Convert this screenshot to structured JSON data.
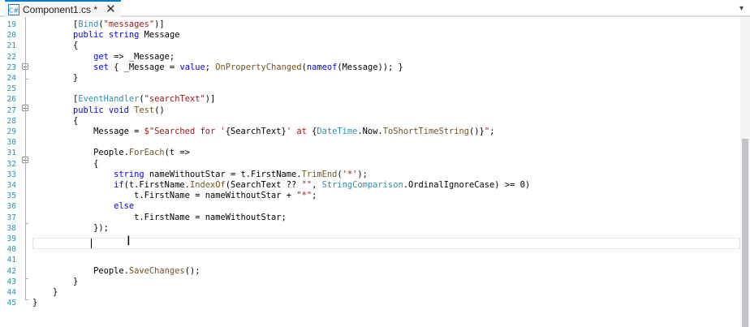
{
  "tab": {
    "title": "Component1.cs *",
    "icon": "csharp-file-icon",
    "close": "✕",
    "overflow": "▾"
  },
  "editor": {
    "lines": [
      {
        "n": "19",
        "indent": "        ",
        "tokens": [
          {
            "t": "[",
            "c": ""
          },
          {
            "t": "Bind",
            "c": "type"
          },
          {
            "t": "(",
            "c": ""
          },
          {
            "t": "\"messages\"",
            "c": "str"
          },
          {
            "t": ")]",
            "c": ""
          }
        ]
      },
      {
        "n": "20",
        "indent": "        ",
        "tokens": [
          {
            "t": "public",
            "c": "kw"
          },
          {
            "t": " ",
            "c": ""
          },
          {
            "t": "string",
            "c": "kw"
          },
          {
            "t": " Message",
            "c": ""
          }
        ]
      },
      {
        "n": "21",
        "indent": "        ",
        "tokens": [
          {
            "t": "{",
            "c": ""
          }
        ]
      },
      {
        "n": "22",
        "indent": "            ",
        "tokens": [
          {
            "t": "get",
            "c": "kw"
          },
          {
            "t": " => _Message;",
            "c": ""
          }
        ]
      },
      {
        "n": "23",
        "indent": "            ",
        "tokens": [
          {
            "t": "set",
            "c": "kw"
          },
          {
            "t": " { _Message = ",
            "c": ""
          },
          {
            "t": "value",
            "c": "kw"
          },
          {
            "t": "; ",
            "c": ""
          },
          {
            "t": "OnPropertyChanged",
            "c": "method"
          },
          {
            "t": "(",
            "c": ""
          },
          {
            "t": "nameof",
            "c": "kw"
          },
          {
            "t": "(Message)); }",
            "c": ""
          }
        ]
      },
      {
        "n": "24",
        "indent": "        ",
        "tokens": [
          {
            "t": "}",
            "c": ""
          }
        ]
      },
      {
        "n": "25",
        "indent": "",
        "tokens": []
      },
      {
        "n": "26",
        "indent": "        ",
        "tokens": [
          {
            "t": "[",
            "c": ""
          },
          {
            "t": "EventHandler",
            "c": "type"
          },
          {
            "t": "(",
            "c": ""
          },
          {
            "t": "\"searchText\"",
            "c": "str"
          },
          {
            "t": ")]",
            "c": ""
          }
        ]
      },
      {
        "n": "27",
        "indent": "        ",
        "tokens": [
          {
            "t": "public",
            "c": "kw"
          },
          {
            "t": " ",
            "c": ""
          },
          {
            "t": "void",
            "c": "kw"
          },
          {
            "t": " ",
            "c": ""
          },
          {
            "t": "Test",
            "c": "method"
          },
          {
            "t": "()",
            "c": ""
          }
        ]
      },
      {
        "n": "28",
        "indent": "        ",
        "tokens": [
          {
            "t": "{",
            "c": ""
          }
        ]
      },
      {
        "n": "29",
        "indent": "            ",
        "tokens": [
          {
            "t": "Message = ",
            "c": ""
          },
          {
            "t": "$\"Searched for '",
            "c": "str"
          },
          {
            "t": "{SearchText}",
            "c": ""
          },
          {
            "t": "' at ",
            "c": "str"
          },
          {
            "t": "{",
            "c": ""
          },
          {
            "t": "DateTime",
            "c": "type"
          },
          {
            "t": ".Now.",
            "c": ""
          },
          {
            "t": "ToShortTimeString",
            "c": "method"
          },
          {
            "t": "()}",
            "c": ""
          },
          {
            "t": "\"",
            "c": "str"
          },
          {
            "t": ";",
            "c": ""
          }
        ]
      },
      {
        "n": "30",
        "indent": "",
        "tokens": []
      },
      {
        "n": "31",
        "indent": "            ",
        "tokens": [
          {
            "t": "People.",
            "c": ""
          },
          {
            "t": "ForEach",
            "c": "method"
          },
          {
            "t": "(t =>",
            "c": ""
          }
        ]
      },
      {
        "n": "32",
        "indent": "            ",
        "tokens": [
          {
            "t": "{",
            "c": ""
          }
        ]
      },
      {
        "n": "33",
        "indent": "                ",
        "tokens": [
          {
            "t": "string",
            "c": "kw"
          },
          {
            "t": " nameWithoutStar = t.FirstName.",
            "c": ""
          },
          {
            "t": "TrimEnd",
            "c": "method"
          },
          {
            "t": "(",
            "c": ""
          },
          {
            "t": "'*'",
            "c": "str"
          },
          {
            "t": ");",
            "c": ""
          }
        ]
      },
      {
        "n": "34",
        "indent": "                ",
        "tokens": [
          {
            "t": "if",
            "c": "kw"
          },
          {
            "t": "(t.FirstName.",
            "c": ""
          },
          {
            "t": "IndexOf",
            "c": "method"
          },
          {
            "t": "(SearchText ?? ",
            "c": ""
          },
          {
            "t": "\"\"",
            "c": "str"
          },
          {
            "t": ", ",
            "c": ""
          },
          {
            "t": "StringComparison",
            "c": "type"
          },
          {
            "t": ".OrdinalIgnoreCase) >= 0)",
            "c": ""
          }
        ]
      },
      {
        "n": "35",
        "indent": "                    ",
        "tokens": [
          {
            "t": "t.FirstName = nameWithoutStar + ",
            "c": ""
          },
          {
            "t": "\"*\"",
            "c": "str"
          },
          {
            "t": ";",
            "c": ""
          }
        ]
      },
      {
        "n": "36",
        "indent": "                ",
        "tokens": [
          {
            "t": "else",
            "c": "kw"
          }
        ]
      },
      {
        "n": "37",
        "indent": "                    ",
        "tokens": [
          {
            "t": "t.FirstName = nameWithoutStar;",
            "c": ""
          }
        ]
      },
      {
        "n": "38",
        "indent": "            ",
        "tokens": [
          {
            "t": "});",
            "c": ""
          }
        ]
      },
      {
        "n": "39",
        "indent": "",
        "tokens": []
      },
      {
        "n": "40",
        "indent": "",
        "tokens": []
      },
      {
        "n": "41",
        "indent": "",
        "tokens": []
      },
      {
        "n": "42",
        "indent": "            ",
        "tokens": [
          {
            "t": "People.",
            "c": ""
          },
          {
            "t": "SaveChanges",
            "c": "method"
          },
          {
            "t": "();",
            "c": ""
          }
        ]
      },
      {
        "n": "43",
        "indent": "        ",
        "tokens": [
          {
            "t": "}",
            "c": ""
          }
        ]
      },
      {
        "n": "44",
        "indent": "    ",
        "tokens": [
          {
            "t": "}",
            "c": ""
          }
        ]
      },
      {
        "n": "45",
        "indent": "",
        "tokens": [
          {
            "t": "}",
            "c": ""
          }
        ]
      }
    ]
  }
}
